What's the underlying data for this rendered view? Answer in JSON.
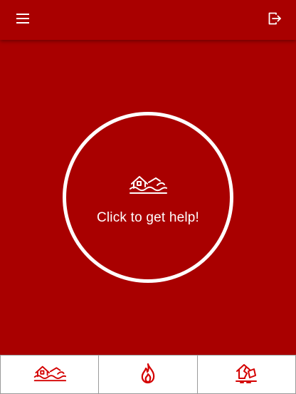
{
  "colors": {
    "background": "#a90000",
    "accent": "#d40000",
    "foreground": "#ffffff"
  },
  "header": {
    "menu_icon": "menu-icon",
    "logout_icon": "logout-icon"
  },
  "main": {
    "help_button_label": "Click to get help!",
    "help_icon": "flood-icon"
  },
  "bottom_nav": {
    "tabs": [
      {
        "icon": "flood-icon"
      },
      {
        "icon": "fire-icon"
      },
      {
        "icon": "earthquake-icon"
      }
    ]
  }
}
